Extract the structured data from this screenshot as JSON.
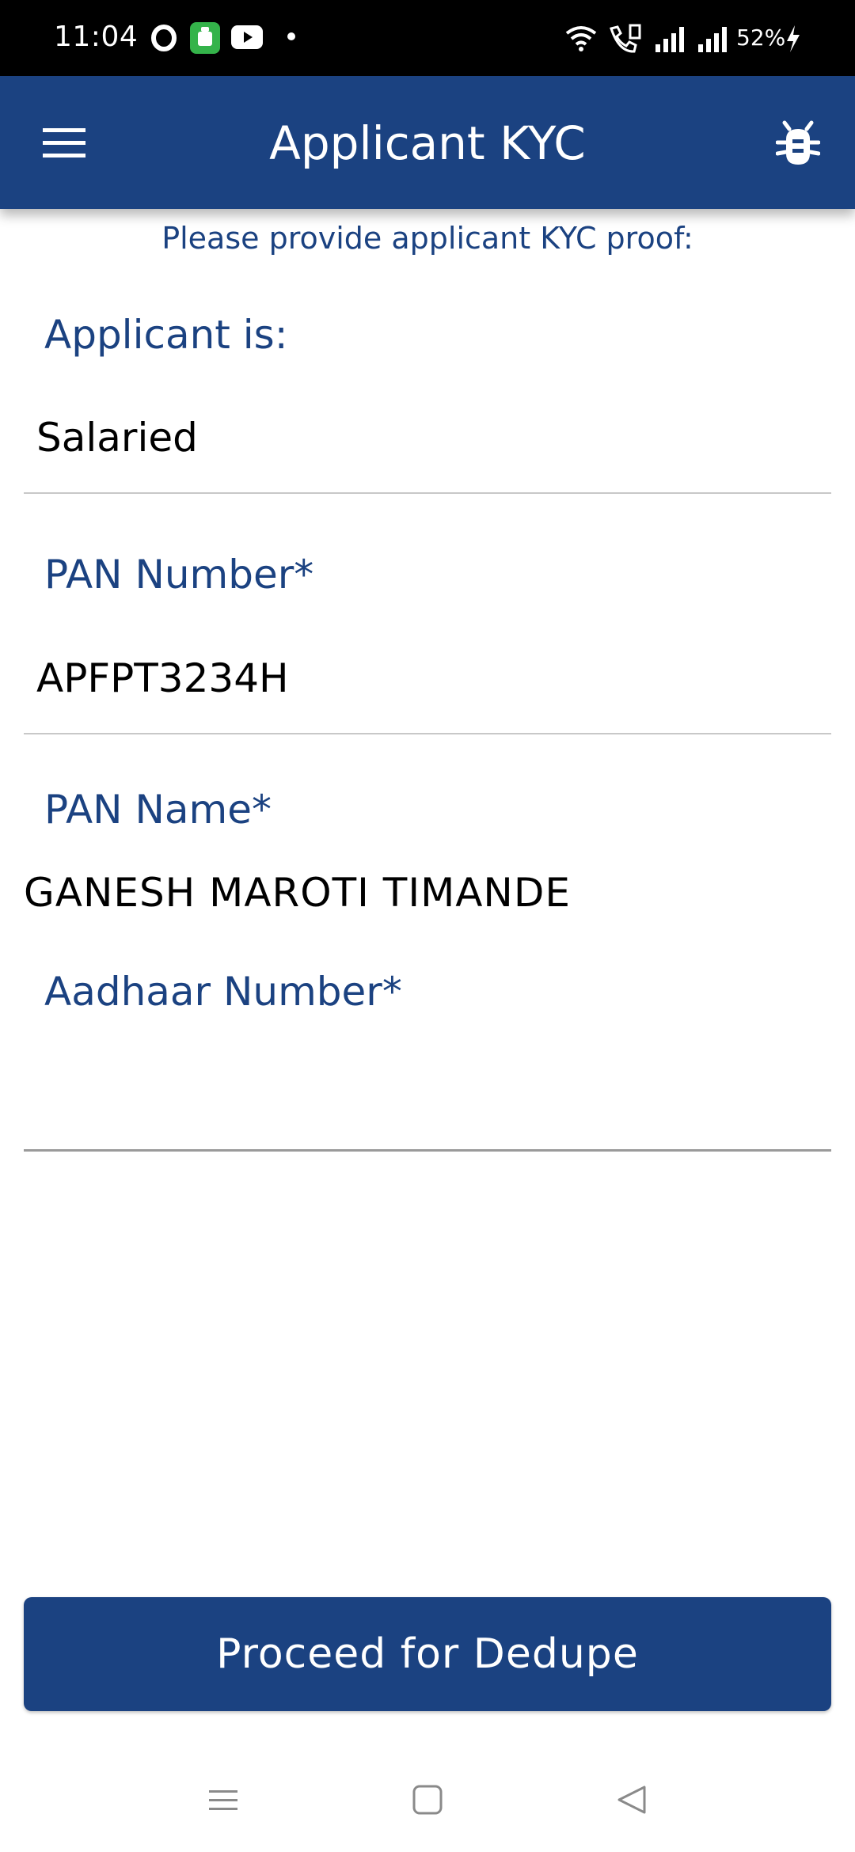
{
  "status_bar": {
    "time": "11:04",
    "battery": "52%",
    "icons": [
      "opera-icon",
      "app-icon",
      "youtube-icon",
      "notification-dot-icon",
      "wifi-icon",
      "wifi-call-icon",
      "signal-icon",
      "signal-icon",
      "charging-icon"
    ]
  },
  "app_bar": {
    "title": "Applicant KYC",
    "left_icon": "menu-icon",
    "right_icon": "bug-icon"
  },
  "form": {
    "subtitle": "Please provide applicant KYC proof:",
    "applicant_type": {
      "label": "Applicant is:",
      "value": "Salaried"
    },
    "pan_number": {
      "label": "PAN Number*",
      "value": "APFPT3234H"
    },
    "pan_name": {
      "label": "PAN Name*",
      "value": "GANESH MAROTI TIMANDE"
    },
    "aadhaar_number": {
      "label": "Aadhaar Number*",
      "value": ""
    }
  },
  "actions": {
    "proceed_label": "Proceed for Dedupe"
  },
  "nav_bar": {
    "icons": [
      "recents-icon",
      "home-icon",
      "back-icon"
    ]
  },
  "colors": {
    "primary": "#1b4281",
    "status_bar": "#000000",
    "background": "#ffffff"
  }
}
